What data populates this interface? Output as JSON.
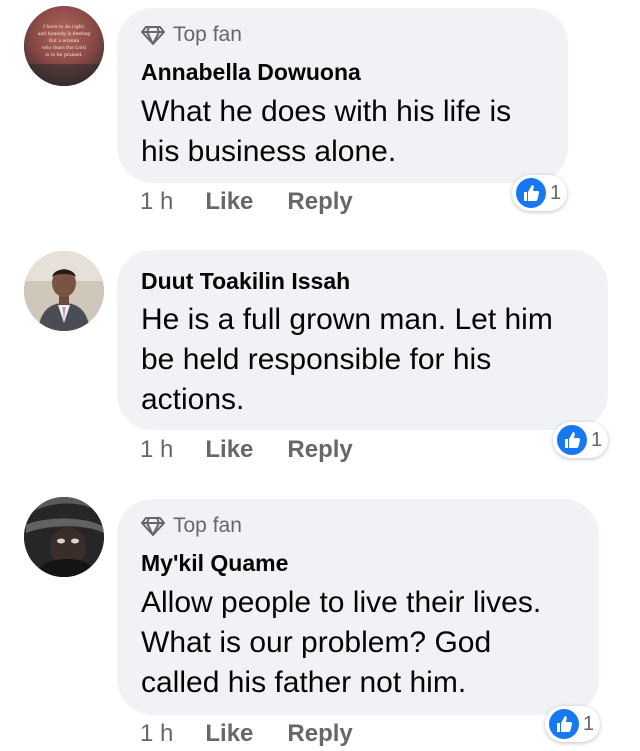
{
  "colors": {
    "bubble": "#f0f2f5",
    "secondary_text": "#65676b",
    "like_blue": "#1877f2"
  },
  "comments": [
    {
      "badge": "Top fan",
      "badge_icon": "diamond-icon",
      "author": "Annabella Dowuona",
      "lines": [
        "What he does with his life is",
        "his business alone."
      ],
      "time": "1 h",
      "like_label": "Like",
      "reply_label": "Reply",
      "reaction_icon": "thumbs-up-icon",
      "reaction_count": "1",
      "avatar_text": [
        "I have to do right,",
        "and honesty is fleeting",
        "But a woman",
        "who fears the Lord",
        "is to be praised."
      ]
    },
    {
      "author": "Duut Toakilin Issah",
      "lines": [
        "He is a full grown man. Let him",
        "be held responsible for his",
        "actions."
      ],
      "time": "1 h",
      "like_label": "Like",
      "reply_label": "Reply",
      "reaction_icon": "thumbs-up-icon",
      "reaction_count": "1"
    },
    {
      "badge": "Top fan",
      "badge_icon": "diamond-icon",
      "author": "My'kil Quame",
      "lines": [
        "Allow people to live their lives.",
        "What is our problem? God",
        "called his father not him."
      ],
      "time": "1 h",
      "like_label": "Like",
      "reply_label": "Reply",
      "reaction_icon": "thumbs-up-icon",
      "reaction_count": "1"
    }
  ]
}
